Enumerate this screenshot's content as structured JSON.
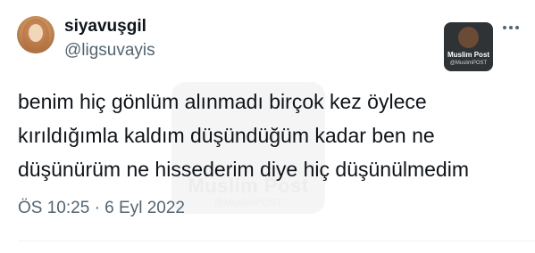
{
  "author": {
    "display_name": "siyavuşgil",
    "handle": "@ligsuvayis",
    "avatar_icon": "profile-avatar"
  },
  "badge": {
    "title": "Muslim Post",
    "subtitle": "@MuslimPOST"
  },
  "more_icon": "more-horizontal-icon",
  "tweet": {
    "lines": [
      "benim hiç gönlüm alınmadı birçok kez öylece",
      "kırıldığımla kaldım düşündüğüm kadar ben ne",
      "düşünürüm ne hissederim diye hiç düşünülmedim"
    ]
  },
  "meta": {
    "time": "ÖS 10:25",
    "separator": "·",
    "date": "6 Eyl 2022"
  },
  "watermark": {
    "title": "Muslim Post",
    "subtitle": "@MuslimPOST"
  },
  "colors": {
    "text_primary": "#0f1419",
    "text_secondary": "#536471",
    "background": "#ffffff"
  }
}
